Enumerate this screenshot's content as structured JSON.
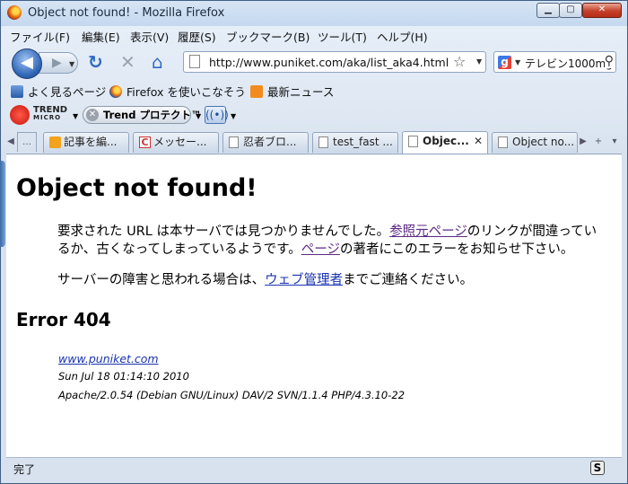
{
  "window": {
    "title": "Object not found! - Mozilla Firefox",
    "min_label": "▁",
    "max_label": "▢",
    "close_label": "✕"
  },
  "menu": [
    "ファイル(F)",
    "編集(E)",
    "表示(V)",
    "履歴(S)",
    "ブックマーク(B)",
    "ツール(T)",
    "ヘルプ(H)"
  ],
  "nav": {
    "back_icon": "◀",
    "forward_icon": "▶",
    "reload_icon": "↻",
    "stop_icon": "✕",
    "home_icon": "⌂",
    "url": "http://www.puniket.com/aka/list_aka4.html",
    "search_value": "テレビン1000mg",
    "search_engine_icon": "g",
    "star_icon": "☆"
  },
  "bookmarks": [
    "よく見るページ",
    "Firefox を使いこなそう",
    "最新ニュース"
  ],
  "trend": {
    "logo_line1": "TREND",
    "logo_line2": "MICRO",
    "protect_label": "Trend プロテクト™",
    "wifi_icon": "((•))"
  },
  "tabs": [
    {
      "label": "記事を編..."
    },
    {
      "label": "メッセー..."
    },
    {
      "label": "忍者ブロ..."
    },
    {
      "label": "test_fast ..."
    },
    {
      "label": "Objec...",
      "active": true
    },
    {
      "label": "Object no..."
    }
  ],
  "tab_scroll_left": "◀",
  "tab_scroll_overflow": "…",
  "tab_scroll_right": "▶",
  "tab_new": "+",
  "tab_list": "▾",
  "page": {
    "heading": "Object not found!",
    "para1_a": "要求された URL は本サーバでは見つかりませんでした。",
    "para1_link1": "参照元ページ",
    "para1_b": "のリンクが間違っているか、古くなってしまっているようです。",
    "para1_link2": "ページ",
    "para1_c": "の著者にこのエラーをお知らせ下さい。",
    "para2_a": "サーバーの障害と思われる場合は、",
    "para2_link": "ウェブ管理者",
    "para2_b": "までご連絡ください。",
    "error_heading": "Error 404",
    "address_link": "www.puniket.com",
    "address_date": "Sun Jul 18 01:14:10 2010",
    "address_server": "Apache/2.0.54 (Debian GNU/Linux) DAV/2 SVN/1.1.4 PHP/4.3.10-22"
  },
  "status": {
    "text": "完了",
    "icon": "S"
  }
}
